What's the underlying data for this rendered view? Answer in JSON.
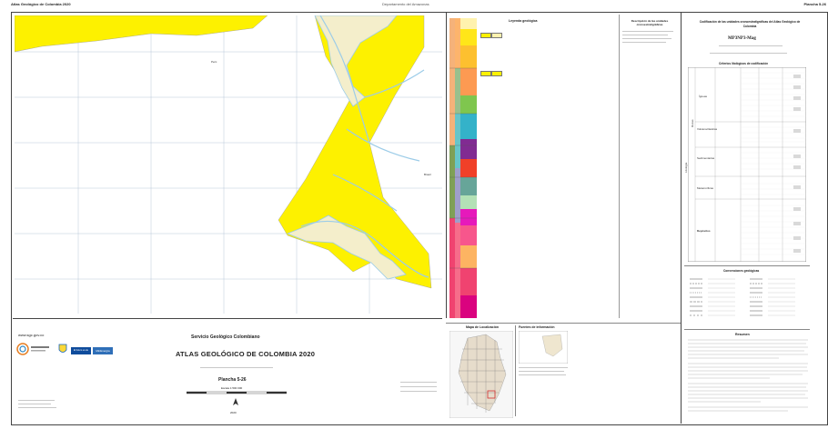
{
  "header": {
    "left": "Atlas Geológico de Colombia 2020",
    "center": "Departamento del Amazonas",
    "right": "Plancha 5-26"
  },
  "map": {
    "label_zone": "Perú",
    "label_east": "Brasil",
    "colors": {
      "water": "#ffffff",
      "neogene": "#fdf100",
      "river_fill": "#f4eecb",
      "river_edge": "#9ccce8",
      "grid": "#b8c8d8"
    }
  },
  "title_block": {
    "website": "www.sgc.gov.co",
    "institution": "Servicio Geológico Colombiano",
    "atlas_title": "ATLAS GEOLÓGICO DE COLOMBIA 2020",
    "sheet": "Plancha 5-26",
    "scale": "Escala 1:500 000",
    "year": "2020",
    "gov_badge": "El futuro es de todos",
    "gov_label": "MinEnergía"
  },
  "legend": {
    "title": "Leyenda geológica",
    "units_title": "Descripción de las unidades cronoestratigráficas"
  },
  "location": {
    "title": "Mapa de Localización",
    "sources": "Fuentes de información"
  },
  "right_panel": {
    "codification": "Codificación de las unidades cronoestratigráficas del Atlas Geológico de Colombia",
    "example_code": "MP3NP3-Mag",
    "criteria": "Criterios litológicos de codificación",
    "conventions": "Convenciones geológicas",
    "summary": "Resumen",
    "category_lito": "Litología",
    "category_rocas": "Rocas",
    "igneas": "Ígneas",
    "volcanoclasticas": "Volcanoclásticas",
    "sedimentarias": "Sedimentarias",
    "metamorficas": "Metamórficas",
    "depositos": "Depósitos"
  }
}
